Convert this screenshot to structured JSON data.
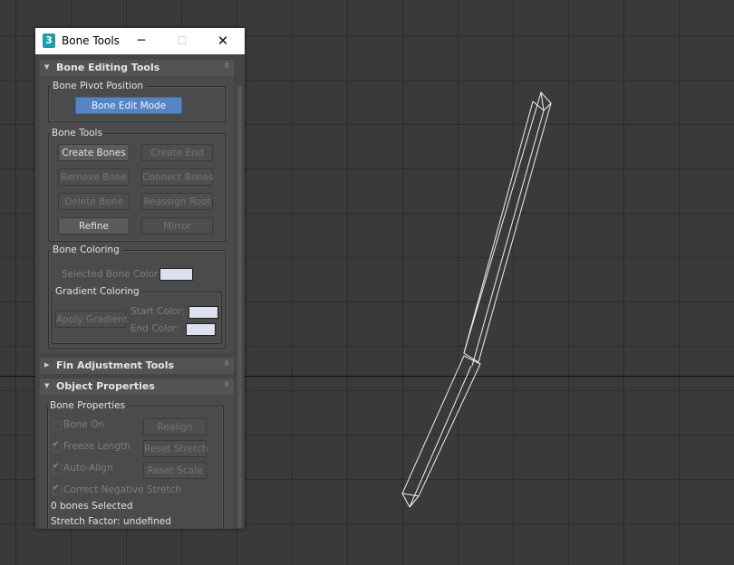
{
  "window": {
    "title": "Bone Tools",
    "app_icon_text": "3",
    "minimize_icon": "minimize-icon",
    "maximize_icon": "maximize-icon",
    "close_icon": "close-icon"
  },
  "rollouts": {
    "bone_editing": {
      "title": "Bone Editing Tools",
      "pivot_group": "Bone Pivot Position",
      "bone_edit_mode": "Bone Edit Mode",
      "bone_tools_group": "Bone Tools",
      "create_bones": "Create Bones",
      "create_end": "Create End",
      "remove_bone": "Remove Bone",
      "connect_bones": "Connect Bones",
      "delete_bone": "Delete Bone",
      "reassign_root": "Reassign Root",
      "refine": "Refine",
      "mirror": "Mirror",
      "coloring_group": "Bone Coloring",
      "selected_bone_color_label": "Selected Bone Color:",
      "gradient_group": "Gradient Coloring",
      "apply_gradient": "Apply Gradient",
      "start_color_label": "Start Color:",
      "end_color_label": "End Color:"
    },
    "fin_adjustment": {
      "title": "Fin Adjustment Tools"
    },
    "object_properties": {
      "title": "Object Properties",
      "bone_properties_group": "Bone Properties",
      "bone_on": "Bone On",
      "realign": "Realign",
      "freeze_length": "Freeze Length",
      "reset_stretch": "Reset Stretch",
      "auto_align": "Auto-Align",
      "reset_scale": "Reset Scale",
      "correct_negative_stretch": "Correct Negative Stretch",
      "bones_selected": "0 bones Selected",
      "stretch_factor": "Stretch Factor: undefined"
    }
  },
  "colors": {
    "swatch": "#dcdff0",
    "accent_button": "#5685c3",
    "viewport_bg": "#3a3a3a"
  }
}
